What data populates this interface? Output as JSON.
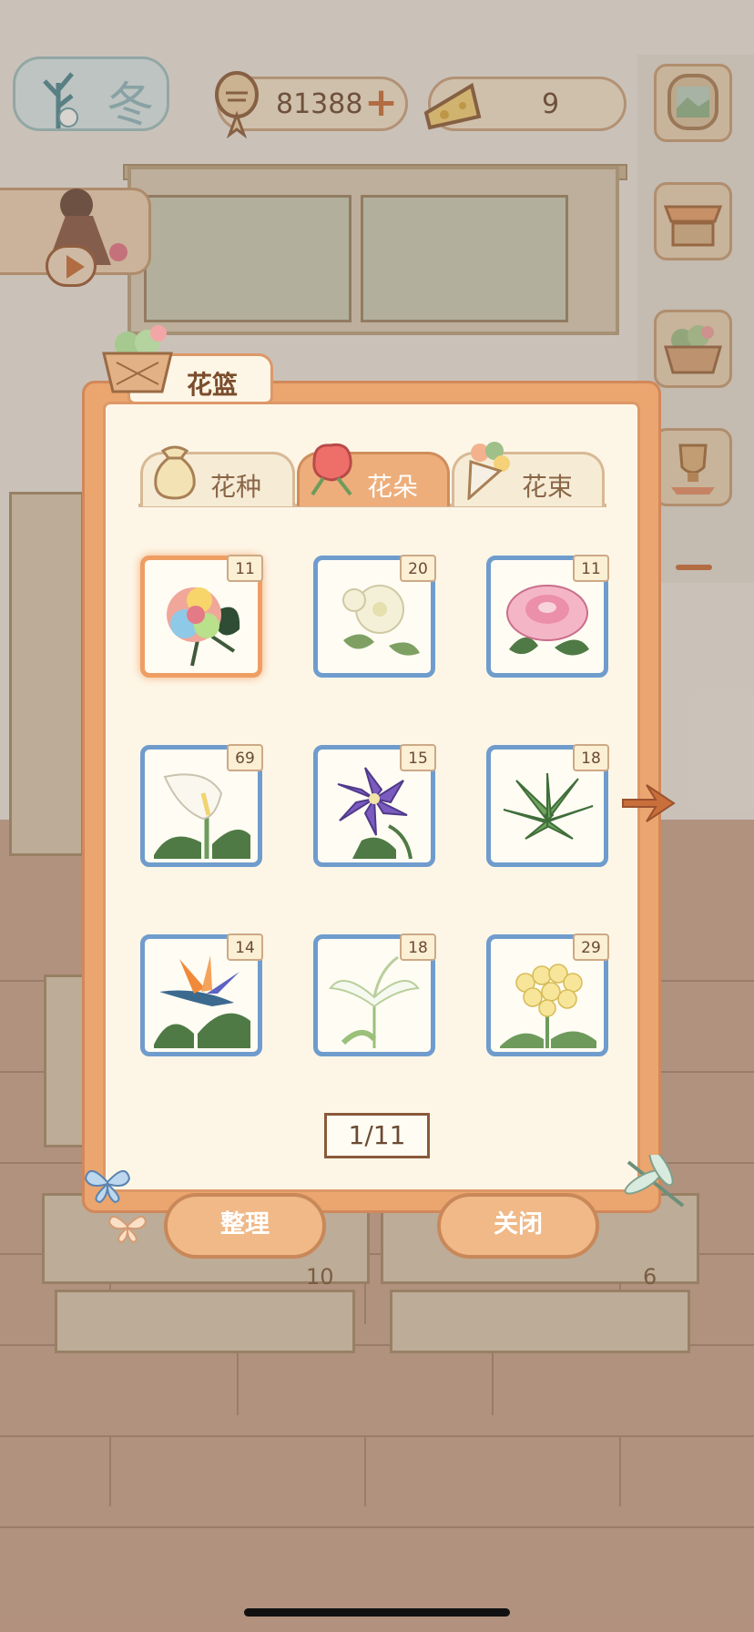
{
  "hud": {
    "season_label": "冬",
    "coins_value": "81388",
    "cheese_value": "9",
    "plus_symbol": "+"
  },
  "background": {
    "table_left_count": "10",
    "table_right_count": "6"
  },
  "panel": {
    "title": "花篮",
    "tabs": [
      {
        "label": "花种",
        "active": false
      },
      {
        "label": "花朵",
        "active": true
      },
      {
        "label": "花束",
        "active": false
      }
    ],
    "items": [
      {
        "name": "rainbow-rose",
        "count": "11",
        "selected": true
      },
      {
        "name": "white-gardenia",
        "count": "20",
        "selected": false
      },
      {
        "name": "pink-peony",
        "count": "11",
        "selected": false
      },
      {
        "name": "calla-lily",
        "count": "69",
        "selected": false
      },
      {
        "name": "purple-clematis",
        "count": "15",
        "selected": false
      },
      {
        "name": "green-succulent",
        "count": "18",
        "selected": false
      },
      {
        "name": "bird-of-paradise",
        "count": "14",
        "selected": false
      },
      {
        "name": "white-egret-orchid",
        "count": "18",
        "selected": false
      },
      {
        "name": "yellow-hydrangea",
        "count": "29",
        "selected": false
      }
    ],
    "pagination": "1/11",
    "buttons": {
      "sort_label": "整理",
      "close_label": "关闭"
    }
  },
  "colors": {
    "panel_frame": "#eba56f",
    "panel_bg": "#fdf6e7",
    "cell_border": "#6f9ccd",
    "selected_border": "#ef9e63",
    "accent": "#c96f3b"
  },
  "icons": [
    "tree-icon",
    "fishbone-icon",
    "cheese-icon",
    "window-icon",
    "shop-stall-icon",
    "basket-icon",
    "trophy-icon",
    "play-icon",
    "seed-bag-icon",
    "flower-icon",
    "bouquet-icon",
    "arrow-right-icon",
    "butterfly-icon",
    "dragonfly-icon"
  ]
}
